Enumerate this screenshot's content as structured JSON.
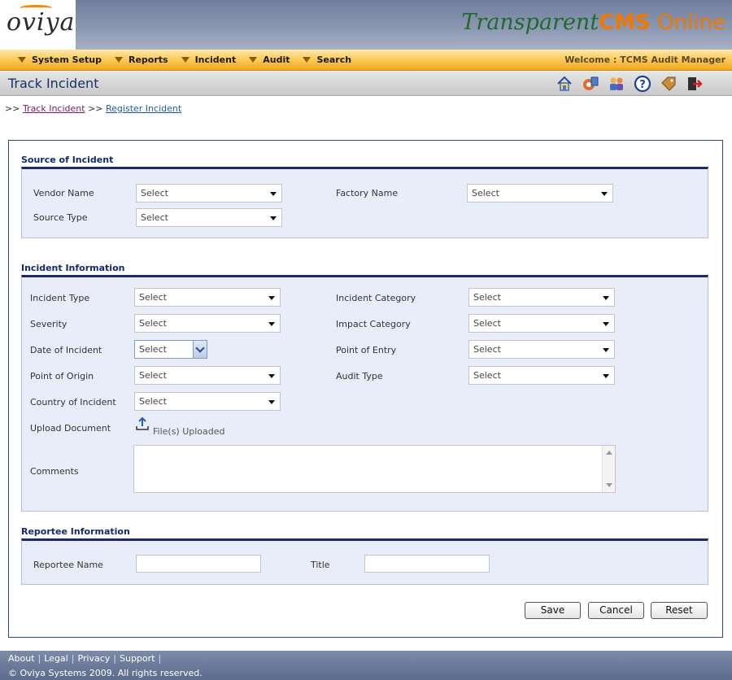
{
  "header": {
    "logo_text": "oviya",
    "brand_part1": "Transparent",
    "brand_part2": "CMS",
    "brand_part3": " Online"
  },
  "menu": {
    "items": [
      "System Setup",
      "Reports",
      "Incident",
      "Audit",
      "Search"
    ],
    "welcome": "Welcome : TCMS Audit Manager"
  },
  "titlebar": {
    "title": "Track Incident",
    "tools": [
      "home-icon",
      "settings-icon",
      "users-icon",
      "help-icon",
      "tag-icon",
      "logout-icon"
    ]
  },
  "breadcrumb": {
    "prefix": ">>",
    "link1": "Track Incident",
    "sep": ">>",
    "link2": "Register Incident"
  },
  "source": {
    "title": "Source of Incident",
    "vendor_label": "Vendor Name",
    "vendor_value": "Select",
    "factory_label": "Factory Name",
    "factory_value": "Select",
    "source_type_label": "Source Type",
    "source_type_value": "Select"
  },
  "incident": {
    "title": "Incident Information",
    "type_label": "Incident Type",
    "type_value": "Select",
    "category_label": "Incident Category",
    "category_value": "Select",
    "severity_label": "Severity",
    "severity_value": "Select",
    "impact_label": "Impact Category",
    "impact_value": "Select",
    "date_label": "Date of Incident",
    "date_value": "Select",
    "entry_label": "Point of Entry",
    "entry_value": "Select",
    "origin_label": "Point of Origin",
    "origin_value": "Select",
    "audit_label": "Audit Type",
    "audit_value": "Select",
    "country_label": "Country of Incident",
    "country_value": "Select",
    "upload_label": "Upload Document",
    "upload_text": "File(s) Uploaded",
    "comments_label": "Comments"
  },
  "reportee": {
    "title": "Reportee Information",
    "name_label": "Reportee Name",
    "title_label": "Title"
  },
  "actions": {
    "save": "Save",
    "cancel": "Cancel",
    "reset": "Reset"
  },
  "footer": {
    "links": [
      "About",
      "Legal",
      "Privacy",
      "Support"
    ],
    "separator": "|",
    "copyright": "© Oviya Systems 2009. All rights reserved."
  }
}
